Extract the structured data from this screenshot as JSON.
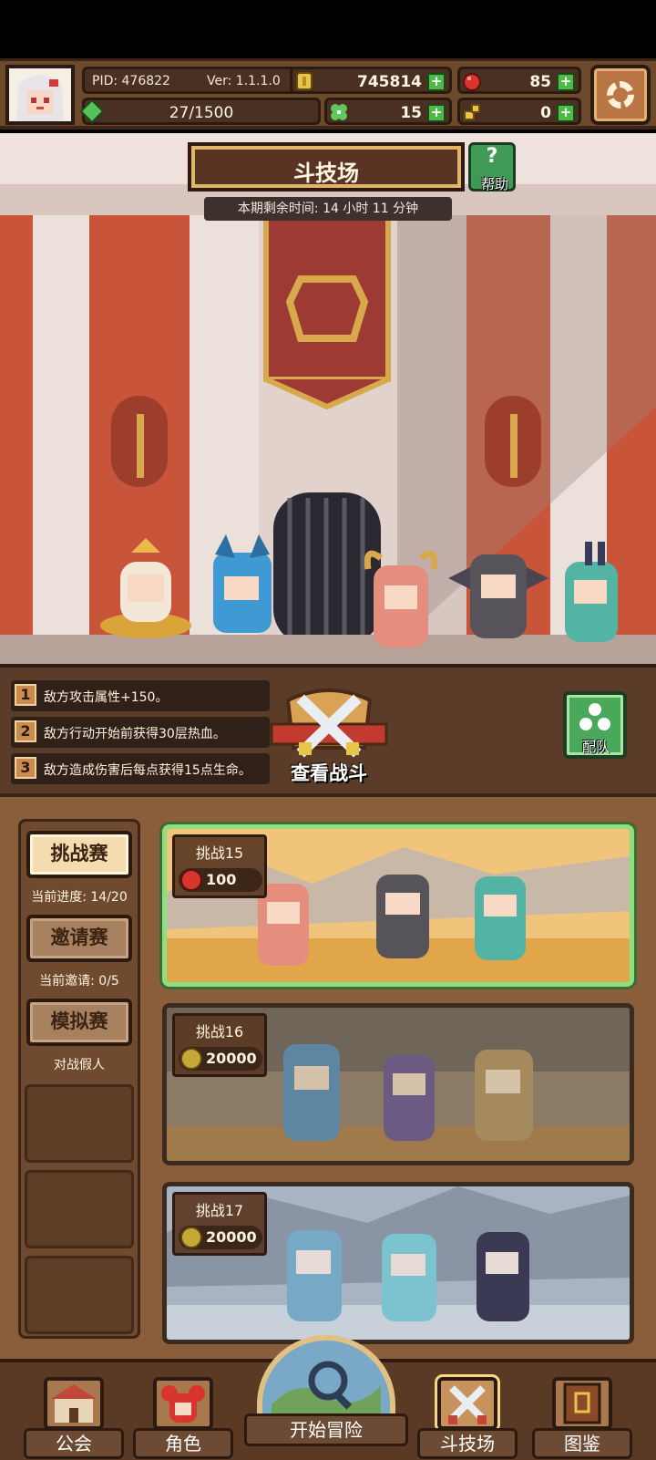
{
  "hud": {
    "pid": "PID: 476822",
    "version": "Ver: 1.1.1.0",
    "coins": "745814",
    "gems": "85",
    "exp": "27/1500",
    "clover": "15",
    "gold_key": "0"
  },
  "arena": {
    "title": "斗技场",
    "help_label": "帮助",
    "help_glyph": "?",
    "timer": "本期剩余时间: 14 小时 11 分钟"
  },
  "modifiers": [
    {
      "num": "1",
      "text": "敌方攻击属性+150。"
    },
    {
      "num": "2",
      "text": "敌方行动开始前获得30层热血。"
    },
    {
      "num": "3",
      "text": "敌方造成伤害后每点获得15点生命。"
    }
  ],
  "actions": {
    "view_battle": "查看战斗",
    "team": "配队"
  },
  "sidebar": {
    "challenge": {
      "label": "挑战赛",
      "sub": "当前进度: 14/20"
    },
    "invite": {
      "label": "邀请赛",
      "sub": "当前邀请: 0/5"
    },
    "mock": {
      "label": "模拟赛",
      "sub": "对战假人"
    }
  },
  "challenges": [
    {
      "name": "挑战15",
      "cost": "100",
      "cost_type": "gem"
    },
    {
      "name": "挑战16",
      "cost": "20000",
      "cost_type": "coin"
    },
    {
      "name": "挑战17",
      "cost": "20000",
      "cost_type": "coin"
    }
  ],
  "nav": {
    "guild": "公会",
    "character": "角色",
    "adventure": "开始冒险",
    "arena": "斗技场",
    "codex": "图鉴"
  },
  "colors": {
    "panel_brown": "#8a5d3b",
    "selected_green": "#8ee07e",
    "plus_green": "#4fb94a",
    "gem_red": "#d8362c",
    "coin_gold": "#e7c44a"
  }
}
